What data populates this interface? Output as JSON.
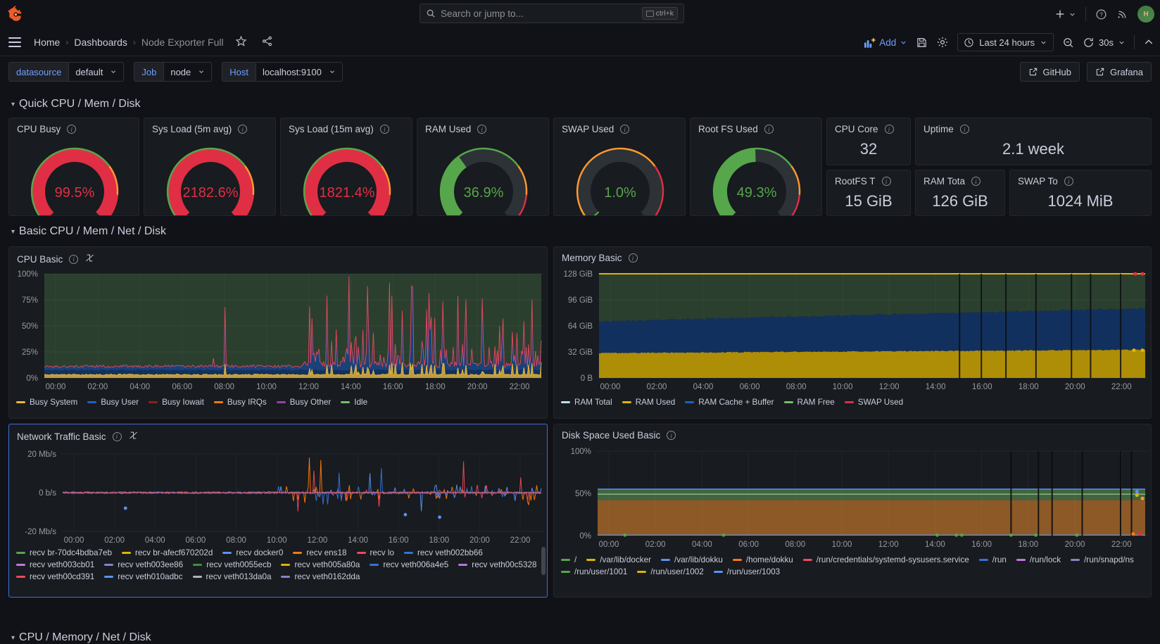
{
  "topnav": {
    "logo": "grafana-logo",
    "search_placeholder": "Search or jump to...",
    "search_shortcut": "ctrl+k",
    "plus_label": "+",
    "help_icon": "help-circle-icon",
    "news_icon": "rss-icon",
    "avatar_initials": "H"
  },
  "breadcrumb": {
    "items": [
      "Home",
      "Dashboards",
      "Node Exporter Full"
    ],
    "star_icon": "star-icon",
    "share_icon": "share-icon",
    "add_label": "Add",
    "save_icon": "save-icon",
    "settings_icon": "gear-icon",
    "time_range": "Last 24 hours",
    "zoom_out_icon": "zoom-out-icon",
    "refresh_interval": "30s",
    "collapse_icon": "chevron-up-icon"
  },
  "variables": [
    {
      "label": "datasource",
      "value": "default"
    },
    {
      "label": "Job",
      "value": "node"
    },
    {
      "label": "Host",
      "value": "localhost:9100"
    }
  ],
  "links": [
    {
      "label": "GitHub",
      "icon": "external-link-icon"
    },
    {
      "label": "Grafana",
      "icon": "external-link-icon"
    }
  ],
  "rows": [
    {
      "title": "Quick CPU / Mem / Disk"
    },
    {
      "title": "Basic CPU / Mem / Net / Disk"
    },
    {
      "title": "CPU / Memory / Net / Disk"
    }
  ],
  "gauges": [
    {
      "title": "CPU Busy",
      "value": "99.5%",
      "percent": 99.5,
      "color": "#e02f44",
      "track": "#56a64b"
    },
    {
      "title": "Sys Load (5m avg)",
      "value": "2182.6%",
      "percent": 100,
      "color": "#e02f44",
      "track": "#56a64b"
    },
    {
      "title": "Sys Load (15m avg)",
      "value": "1821.4%",
      "percent": 100,
      "color": "#e02f44",
      "track": "#56a64b"
    },
    {
      "title": "RAM Used",
      "value": "36.9%",
      "percent": 36.9,
      "color": "#56a64b",
      "track": "#56a64b"
    },
    {
      "title": "SWAP Used",
      "value": "1.0%",
      "percent": 1.0,
      "color": "#56a64b",
      "track": "#e02f44"
    },
    {
      "title": "Root FS Used",
      "value": "49.3%",
      "percent": 49.3,
      "color": "#56a64b",
      "track": "#56a64b"
    }
  ],
  "stats": [
    {
      "title": "CPU Core",
      "value": "32"
    },
    {
      "title": "Uptime",
      "value": "2.1 week"
    },
    {
      "title": "RootFS T",
      "value": "15 GiB"
    },
    {
      "title": "RAM Tota",
      "value": "126 GiB"
    },
    {
      "title": "SWAP To",
      "value": "1024 MiB"
    }
  ],
  "chart_data": [
    {
      "id": "cpu_basic",
      "type": "area",
      "title": "CPU Basic",
      "stacked": true,
      "ylabel": "",
      "ytick_labels": [
        "100%",
        "75%",
        "50%",
        "25%",
        "0%"
      ],
      "ylim": [
        0,
        100
      ],
      "xtick_labels": [
        "00:00",
        "02:00",
        "04:00",
        "06:00",
        "08:00",
        "10:00",
        "12:00",
        "14:00",
        "16:00",
        "18:00",
        "20:00",
        "22:00"
      ],
      "legend_position": "bottom",
      "series": [
        {
          "name": "Busy System",
          "color": "#eab839",
          "mean": 3
        },
        {
          "name": "Busy User",
          "color": "#1f60c4",
          "mean": 7
        },
        {
          "name": "Busy Iowait",
          "color": "#8f1f1f",
          "mean": 1
        },
        {
          "name": "Busy IRQs",
          "color": "#ff780a",
          "mean": 0.3
        },
        {
          "name": "Busy Other",
          "color": "#9a3fa8",
          "mean": 0.3
        },
        {
          "name": "Idle",
          "color": "#73bf69",
          "mean": 88
        }
      ]
    },
    {
      "id": "memory_basic",
      "type": "area",
      "title": "Memory Basic",
      "stacked": true,
      "ytick_labels": [
        "128 GiB",
        "96 GiB",
        "64 GiB",
        "32 GiB",
        "0 B"
      ],
      "ylim": [
        0,
        137438953472
      ],
      "xtick_labels": [
        "00:00",
        "02:00",
        "04:00",
        "06:00",
        "08:00",
        "10:00",
        "12:00",
        "14:00",
        "16:00",
        "18:00",
        "20:00",
        "22:00"
      ],
      "legend_position": "bottom",
      "series": [
        {
          "name": "RAM Total",
          "color": "#badff4"
        },
        {
          "name": "RAM Used",
          "color": "#e0b400"
        },
        {
          "name": "RAM Cache + Buffer",
          "color": "#1f60c4"
        },
        {
          "name": "RAM Free",
          "color": "#73bf69"
        },
        {
          "name": "SWAP Used",
          "color": "#e02f44"
        }
      ]
    },
    {
      "id": "network_traffic_basic",
      "type": "line",
      "title": "Network Traffic Basic",
      "ytick_labels": [
        "20 Mb/s",
        "0 b/s",
        "-20 Mb/s"
      ],
      "ylim": [
        -30000000,
        30000000
      ],
      "xtick_labels": [
        "00:00",
        "02:00",
        "04:00",
        "06:00",
        "08:00",
        "10:00",
        "12:00",
        "14:00",
        "16:00",
        "18:00",
        "20:00",
        "22:00"
      ],
      "legend_position": "bottom",
      "series": [
        {
          "name": "recv br-70dc4bdba7eb",
          "color": "#56a64b"
        },
        {
          "name": "recv br-afecf670202d",
          "color": "#e0b400"
        },
        {
          "name": "recv docker0",
          "color": "#5794f2"
        },
        {
          "name": "recv ens18",
          "color": "#ff780a"
        },
        {
          "name": "recv lo",
          "color": "#f2495c"
        },
        {
          "name": "recv veth002bb66",
          "color": "#3274d9"
        },
        {
          "name": "recv veth003cb01",
          "color": "#c377dd"
        },
        {
          "name": "recv veth003ee86",
          "color": "#8f7fc7"
        },
        {
          "name": "recv veth0055ecb",
          "color": "#3f8f3f"
        },
        {
          "name": "recv veth005a80a",
          "color": "#e0b400"
        },
        {
          "name": "recv veth006a4e5",
          "color": "#3274d9"
        },
        {
          "name": "recv veth00c5328",
          "color": "#b877d9"
        },
        {
          "name": "recv veth00cd391",
          "color": "#f2495c"
        },
        {
          "name": "recv veth010adbc",
          "color": "#5794f2"
        },
        {
          "name": "recv veth013da0a",
          "color": "#b3b3b3"
        },
        {
          "name": "recv veth0162dda",
          "color": "#8f7fc7"
        }
      ]
    },
    {
      "id": "disk_space_used_basic",
      "type": "area",
      "title": "Disk Space Used Basic",
      "ytick_labels": [
        "100%",
        "50%",
        "0%"
      ],
      "ylim": [
        0,
        100
      ],
      "xtick_labels": [
        "00:00",
        "02:00",
        "04:00",
        "06:00",
        "08:00",
        "10:00",
        "12:00",
        "14:00",
        "16:00",
        "18:00",
        "20:00",
        "22:00"
      ],
      "legend_position": "bottom",
      "series": [
        {
          "name": "/",
          "color": "#56a64b"
        },
        {
          "name": "/var/lib/docker",
          "color": "#e0b400"
        },
        {
          "name": "/var/lib/dokku",
          "color": "#5794f2"
        },
        {
          "name": "/home/dokku",
          "color": "#ff780a"
        },
        {
          "name": "/run/credentials/systemd-sysusers.service",
          "color": "#f2495c"
        },
        {
          "name": "/run",
          "color": "#3274d9"
        },
        {
          "name": "/run/lock",
          "color": "#c377dd"
        },
        {
          "name": "/run/snapd/ns",
          "color": "#8f7fc7"
        },
        {
          "name": "/run/user/1001",
          "color": "#56a64b"
        },
        {
          "name": "/run/user/1002",
          "color": "#e0b400"
        },
        {
          "name": "/run/user/1003",
          "color": "#5794f2"
        }
      ]
    }
  ],
  "panel_icons": {
    "info": "info-icon",
    "datalinks": "datalinks-icon"
  }
}
